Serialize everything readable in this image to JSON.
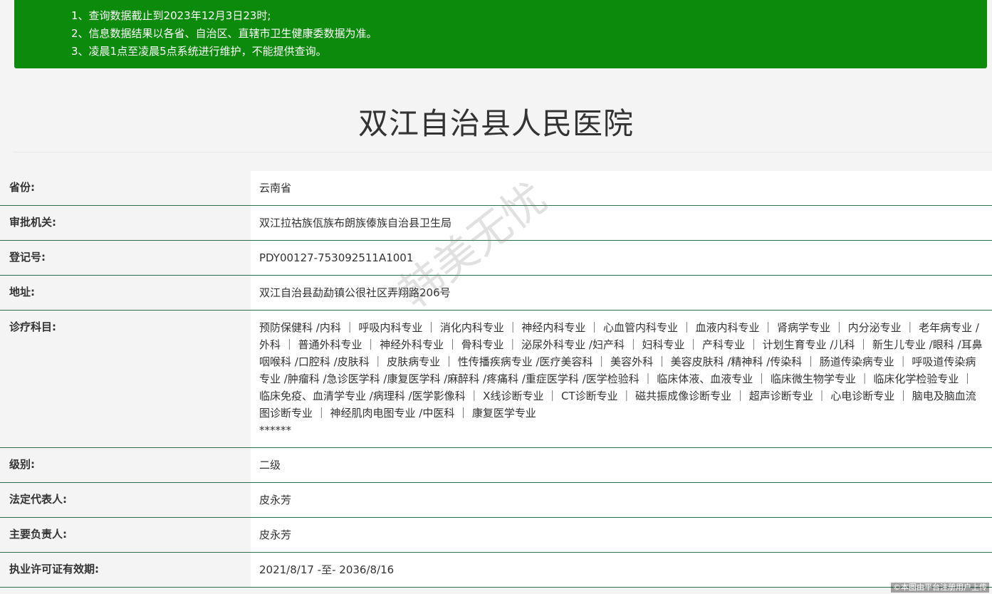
{
  "notice": {
    "lines": [
      "1、查询数据截止到2023年12月3日23时;",
      "2、信息数据结果以各省、自治区、直辖市卫生健康委数据为准。",
      "3、凌晨1点至凌晨5点系统进行维护，不能提供查询。"
    ]
  },
  "hospital": {
    "name": "双江自治县人民医院"
  },
  "rows": {
    "province": {
      "label": "省份:",
      "value": "云南省"
    },
    "authority": {
      "label": "审批机关:",
      "value": "双江拉祜族佤族布朗族傣族自治县卫生局"
    },
    "reg_no": {
      "label": "登记号:",
      "value": "PDY00127-753092511A1001"
    },
    "address": {
      "label": "地址:",
      "value": "双江自治县勐勐镇公很社区弄翔路206号"
    },
    "departments": {
      "label": "诊疗科目:",
      "value": "预防保健科 /内科 ｜ 呼吸内科专业 ｜ 消化内科专业 ｜ 神经内科专业 ｜ 心血管内科专业 ｜ 血液内科专业 ｜ 肾病学专业 ｜ 内分泌专业 ｜ 老年病专业 /外科 ｜ 普通外科专业 ｜ 神经外科专业 ｜ 骨科专业 ｜ 泌尿外科专业 /妇产科 ｜ 妇科专业 ｜ 产科专业 ｜ 计划生育专业 /儿科 ｜ 新生儿专业 /眼科 /耳鼻咽喉科 /口腔科 /皮肤科 ｜ 皮肤病专业 ｜ 性传播疾病专业 /医疗美容科 ｜ 美容外科 ｜ 美容皮肤科 /精神科 /传染科 ｜ 肠道传染病专业 ｜ 呼吸道传染病专业 /肿瘤科 /急诊医学科 /康复医学科 /麻醉科 /疼痛科 /重症医学科 /医学检验科 ｜ 临床体液、血液专业 ｜ 临床微生物学专业 ｜ 临床化学检验专业 ｜ 临床免疫、血清学专业 /病理科 /医学影像科 ｜ X线诊断专业 ｜ CT诊断专业 ｜ 磁共振成像诊断专业 ｜ 超声诊断专业 ｜ 心电诊断专业 ｜ 脑电及脑血流图诊断专业 ｜ 神经肌肉电图专业 /中医科 ｜ 康复医学专业",
      "suffix": "******"
    },
    "level": {
      "label": "级别:",
      "value": "二级"
    },
    "legal_rep": {
      "label": "法定代表人:",
      "value": "皮永芳"
    },
    "principal": {
      "label": "主要负责人:",
      "value": "皮永芳"
    },
    "license_validity": {
      "label": "执业许可证有效期:",
      "value": "2021/8/17 -至- 2036/8/16"
    }
  },
  "watermark": {
    "text": "韩美无忧"
  },
  "credit": {
    "text": "©本图由平台注册用户上传"
  },
  "colors": {
    "notice_bg": "#0b8a0b",
    "row_border": "#2f6f4f"
  }
}
